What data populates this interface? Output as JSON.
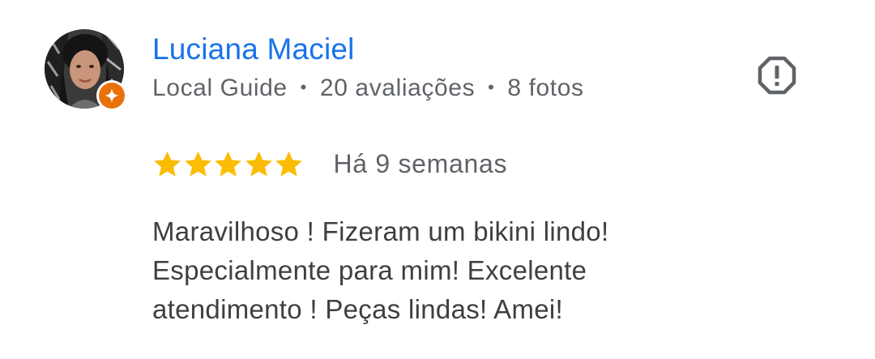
{
  "review": {
    "author": {
      "name": "Luciana Maciel",
      "level": "Local Guide",
      "separator": "•",
      "reviews_count": "20 avaliações",
      "photos_count": "8 fotos",
      "avatar_icon": "user-photo",
      "badge_icon": "local-guide-badge-icon",
      "badge_color": "#e8710a"
    },
    "flag_icon": "report-flag-icon",
    "rating": 5,
    "rating_max": 5,
    "star_color": "#fbbc04",
    "date": "Há 9 semanas",
    "text_lines": [
      "Maravilhoso ! Fizeram um bikini lindo!",
      "Especialmente para mim! Excelente",
      "atendimento ! Peças lindas! Amei!"
    ]
  },
  "colors": {
    "name": "#1a73e8",
    "meta": "#5f6368",
    "body": "#3c4043"
  }
}
